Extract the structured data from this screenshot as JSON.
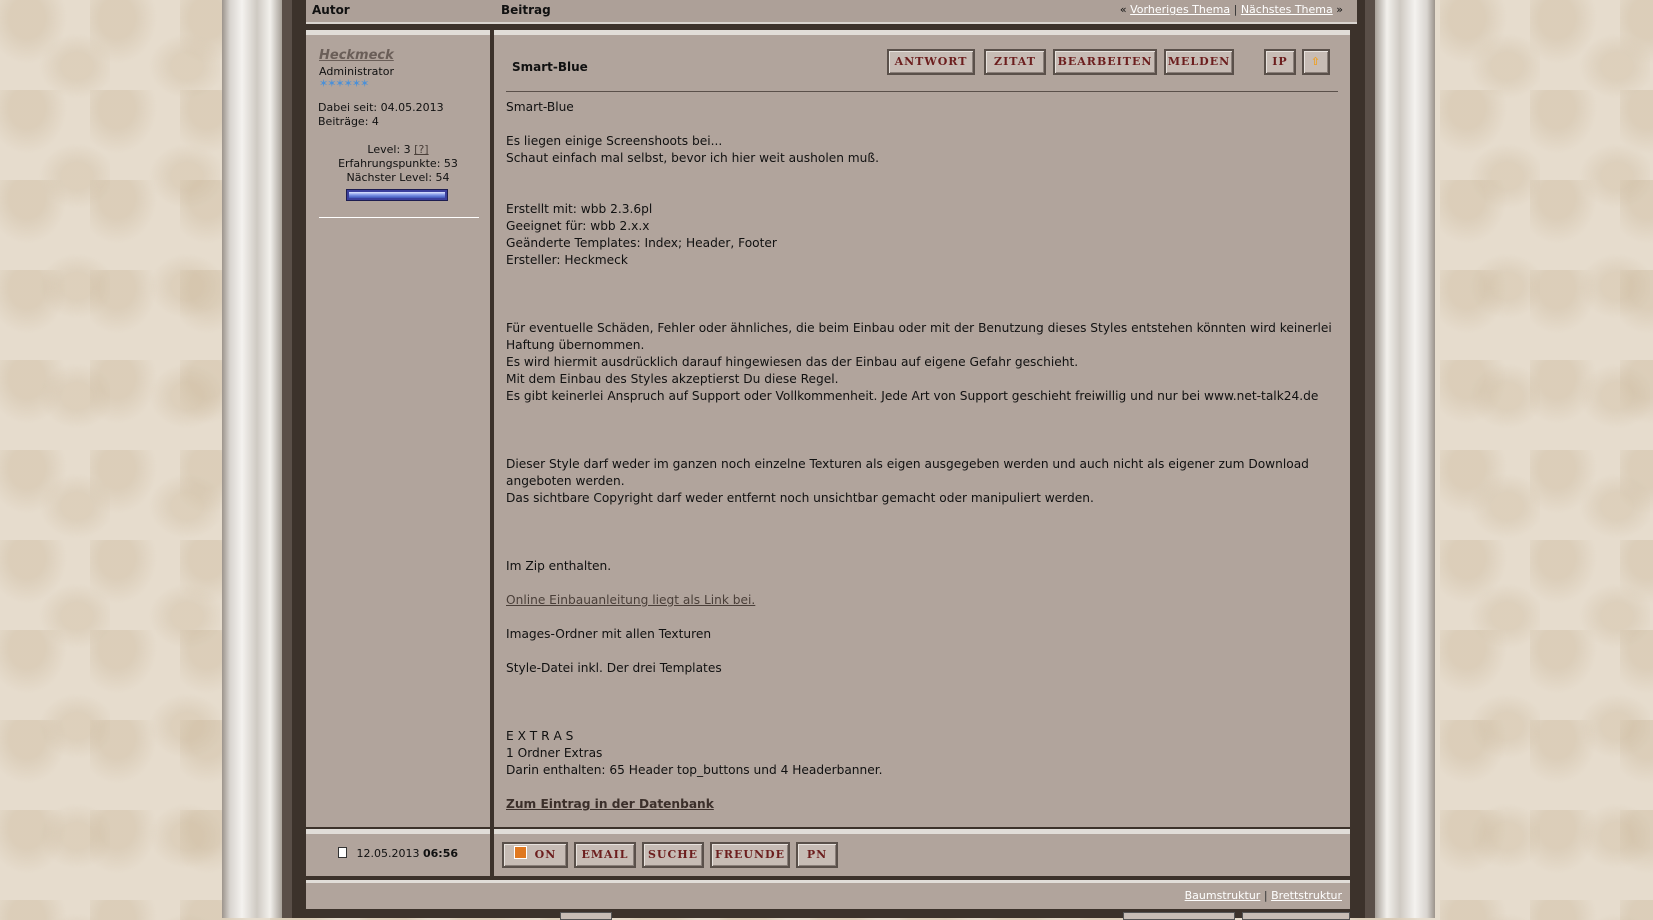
{
  "header": {
    "autor": "Autor",
    "beitrag": "Beitrag",
    "prev_arrow": "«",
    "prev_topic": "Vorheriges Thema",
    "separator": "|",
    "next_topic": "Nächstes Thema",
    "next_arrow": "»"
  },
  "user": {
    "name": "Heckmeck",
    "rank": "Administrator",
    "stars": "✶✶✶✶✶✶",
    "joined": "Dabei seit: 04.05.2013",
    "posts": "Beiträge: 4",
    "level_label": "Level: 3",
    "level_help": "[?]",
    "xp": "Erfahrungspunkte: 53",
    "next_level": "Nächster Level: 54",
    "level_progress": 1.0
  },
  "post": {
    "title": "Smart-Blue",
    "buttons": {
      "reply": "ANTWORT",
      "quote": "ZITAT",
      "edit": "BEARBEITEN",
      "report": "MELDEN",
      "ip": "IP",
      "top_icon": "up-arrow-icon"
    },
    "lines": [
      "Smart-Blue",
      "Es liegen einige Screenshoots bei...",
      "Schaut einfach mal selbst, bevor ich hier weit ausholen muß.",
      "Erstellt mit: wbb 2.3.6pl",
      "Geeignet für: wbb 2.x.x",
      "Geänderte Templates: Index; Header, Footer",
      "Ersteller: Heckmeck",
      "Für eventuelle Schäden, Fehler oder ähnliches, die beim Einbau oder mit der Benutzung dieses Styles entstehen könnten wird keinerlei Haftung übernommen.",
      "Es wird hiermit ausdrücklich darauf hingewiesen das der Einbau auf eigene Gefahr geschieht.",
      "Mit dem Einbau des Styles akzeptierst Du diese Regel.",
      "Es gibt keinerlei Anspruch auf Support oder Vollkommenheit. Jede Art von Support geschieht freiwillig und nur bei www.net-talk24.de",
      "Dieser Style darf weder im ganzen noch einzelne Texturen als eigen ausgegeben werden und auch nicht als eigener zum Download angeboten werden.",
      "Das sichtbare Copyright darf weder entfernt noch unsichtbar gemacht oder manipuliert werden.",
      "Im Zip enthalten.",
      "Online Einbauanleitung liegt als Link bei.",
      "Images-Ordner mit allen Texturen",
      "Style-Datei inkl. Der drei Templates",
      "E X T R A S",
      "1 Ordner Extras",
      "Darin enthalten: 65 Header top_buttons und 4 Headerbanner.",
      "Zum Eintrag in der Datenbank"
    ]
  },
  "bottom": {
    "date": "12.05.2013",
    "time": "06:56",
    "buttons": {
      "online": "ON",
      "email": "EMAIL",
      "search": "SUCHE",
      "friends": "FREUNDE",
      "pm": "PN"
    }
  },
  "footer": {
    "tree": "Baumstruktur",
    "separator": "|",
    "board": "Brettstruktur"
  }
}
